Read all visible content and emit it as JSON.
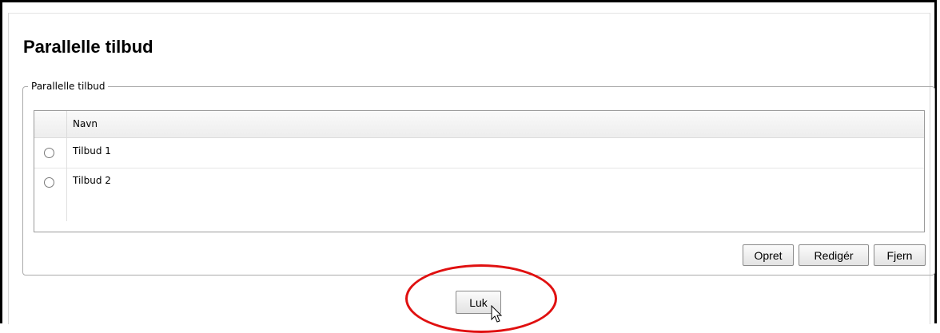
{
  "page": {
    "title": "Parallelle tilbud"
  },
  "group": {
    "legend": "Parallelle tilbud"
  },
  "grid": {
    "columns": [
      "Navn"
    ],
    "rows": [
      {
        "name": "Tilbud 1",
        "selected": false
      },
      {
        "name": "Tilbud 2",
        "selected": false
      }
    ]
  },
  "actions": {
    "create_label": "Opret",
    "edit_label": "Redigér",
    "remove_label": "Fjern"
  },
  "footer": {
    "close_label": "Luk"
  },
  "annotation": {
    "highlight_color": "#e01010"
  }
}
